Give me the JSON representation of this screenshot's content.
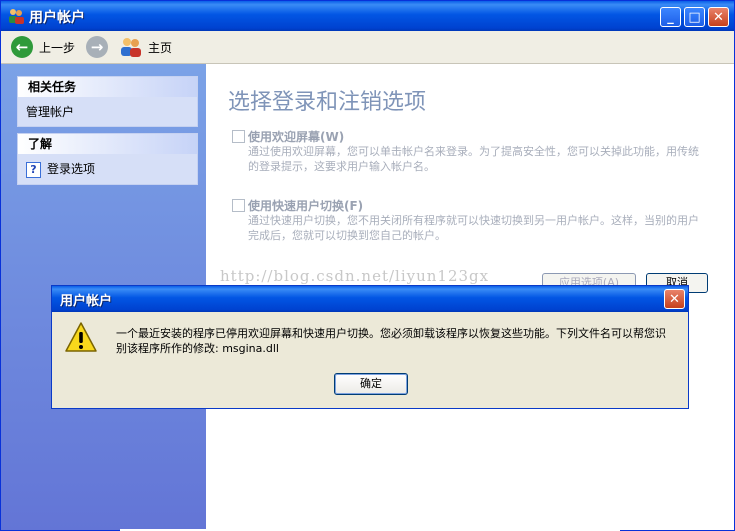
{
  "window": {
    "title": "用户帐户",
    "icon": "users-icon",
    "controls": [
      "minimize-icon",
      "maximize-icon",
      "close-icon"
    ]
  },
  "toolbar": {
    "back_label": "上一步",
    "home_label": "主页"
  },
  "sidebar": {
    "related_tasks": {
      "header": "相关任务",
      "items": [
        "管理帐户"
      ]
    },
    "learn": {
      "header": "了解",
      "items": [
        "登录选项"
      ]
    }
  },
  "main": {
    "heading": "选择登录和注销选项",
    "option1": {
      "label": "使用欢迎屏幕(W)",
      "description": "通过使用欢迎屏幕，您可以单击帐户名来登录。为了提高安全性，您可以关掉此功能，用传统的登录提示，这要求用户输入帐户名。"
    },
    "option2": {
      "label": "使用快速用户切换(F)",
      "description": "通过快速用户切换，您不用关闭所有程序就可以快速切换到另一用户帐户。这样，当别的用户完成后，您就可以切换到您自己的帐户。"
    },
    "apply_button": "应用选项(A)",
    "cancel_button": "取消",
    "watermark": "http://blog.csdn.net/liyun123gx"
  },
  "dialog": {
    "title": "用户帐户",
    "message": "一个最近安装的程序已停用欢迎屏幕和快速用户切换。您必须卸载该程序以恢复这些功能。下列文件名可以帮您识别该程序所作的修改: msgina.dll",
    "ok_button": "确定",
    "icon": "warning-icon"
  },
  "colors": {
    "titlebar": "#0256e4",
    "taskpane": "#7ba2e7",
    "heading": "#7f94b8"
  }
}
